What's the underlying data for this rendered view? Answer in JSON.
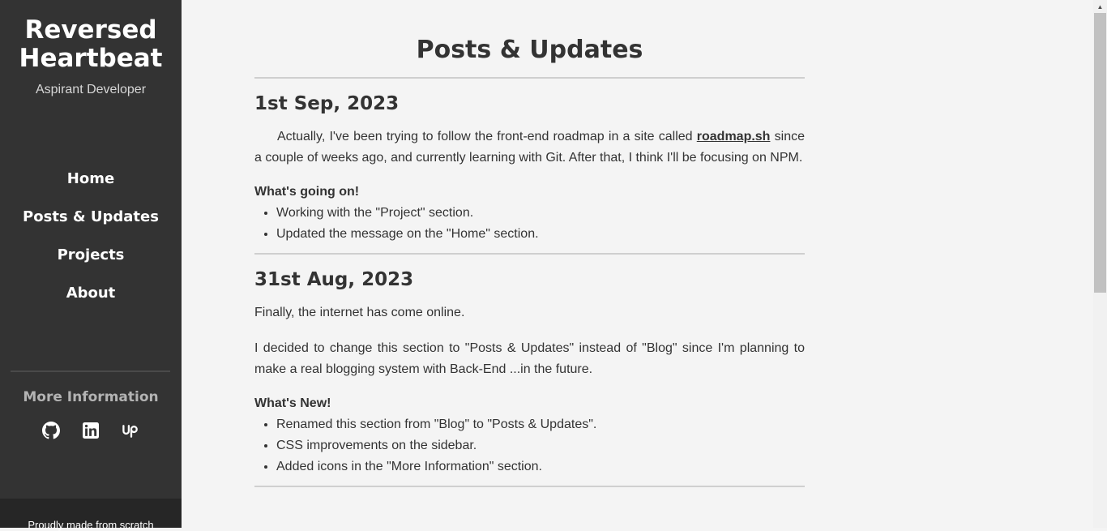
{
  "sidebar": {
    "brand_line1": "Reversed",
    "brand_line2": "Heartbeat",
    "tagline": "Aspirant Developer",
    "nav": [
      {
        "label": "Home"
      },
      {
        "label": "Posts & Updates"
      },
      {
        "label": "Projects"
      },
      {
        "label": "About"
      }
    ],
    "more_info_heading": "More Information",
    "social_icons": [
      "github-icon",
      "linkedin-icon",
      "upwork-icon"
    ],
    "footer_text": "Proudly made from scratch"
  },
  "main": {
    "title": "Posts & Updates",
    "posts": [
      {
        "date": "1st Sep, 2023",
        "intro_before_link": "Actually, I've been trying to follow the front-end roadmap in a site called ",
        "link_text": "roadmap.sh",
        "intro_after_link": " since a couple of weeks ago, and currently learning with Git. After that, I think I'll be focusing on NPM.",
        "list_heading": "What's going on!",
        "items": [
          "Working with the \"Project\" section.",
          "Updated the message on the \"Home\" section."
        ]
      },
      {
        "date": "31st Aug, 2023",
        "para1": "Finally, the internet has come online.",
        "para2": "I decided to change this section to \"Posts & Updates\" instead of \"Blog\" since I'm planning to make a real blogging system with Back-End ...in the future.",
        "list_heading": "What's New!",
        "items": [
          "Renamed this section from \"Blog\" to \"Posts & Updates\".",
          "CSS improvements on the sidebar.",
          "Added icons in the \"More Information\" section."
        ]
      }
    ]
  },
  "colors": {
    "sidebar_bg": "#333333",
    "page_bg": "#f4f4f4",
    "text": "#333333"
  }
}
